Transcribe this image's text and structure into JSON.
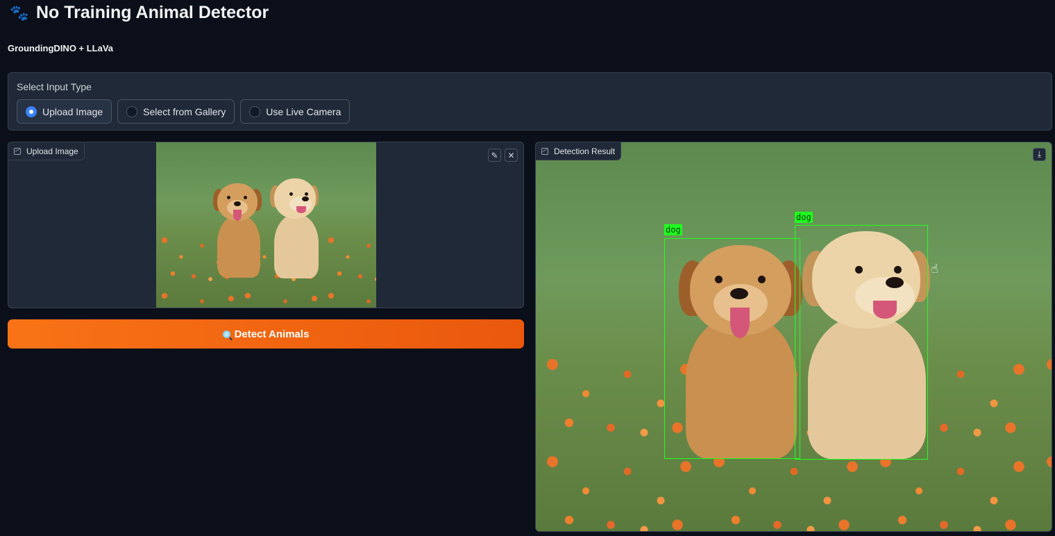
{
  "header": {
    "title": "No Training Animal Detector",
    "subtitle": "GroundingDINO + LLaVa"
  },
  "input_type": {
    "label": "Select Input Type",
    "options": [
      {
        "label": "Upload Image",
        "selected": true
      },
      {
        "label": "Select from Gallery",
        "selected": false
      },
      {
        "label": "Use Live Camera",
        "selected": false
      }
    ]
  },
  "upload_panel": {
    "label": "Upload Image"
  },
  "result_panel": {
    "label": "Detection Result",
    "detections": [
      {
        "label": "dog"
      },
      {
        "label": "dog"
      }
    ]
  },
  "detect_button": {
    "label": "Detect Animals"
  },
  "colors": {
    "accent": "#f97316",
    "bbox": "#22ff22",
    "radio_selected": "#3b82f6",
    "background": "#0b0f19"
  },
  "icons": [
    "paw-icon",
    "image-icon",
    "edit-icon",
    "close-icon",
    "download-icon",
    "magnifier-icon"
  ]
}
